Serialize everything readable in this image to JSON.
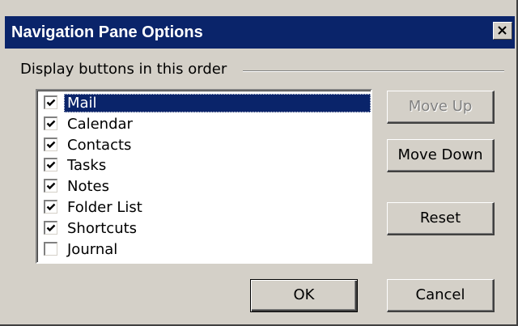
{
  "dialog": {
    "title": "Navigation Pane Options",
    "group_label": "Display buttons in this order"
  },
  "items": [
    {
      "label": "Mail",
      "checked": true,
      "selected": true
    },
    {
      "label": "Calendar",
      "checked": true,
      "selected": false
    },
    {
      "label": "Contacts",
      "checked": true,
      "selected": false
    },
    {
      "label": "Tasks",
      "checked": true,
      "selected": false
    },
    {
      "label": "Notes",
      "checked": true,
      "selected": false
    },
    {
      "label": "Folder List",
      "checked": true,
      "selected": false
    },
    {
      "label": "Shortcuts",
      "checked": true,
      "selected": false
    },
    {
      "label": "Journal",
      "checked": false,
      "selected": false
    }
  ],
  "buttons": {
    "move_up": "Move Up",
    "move_down": "Move Down",
    "reset": "Reset",
    "ok": "OK",
    "cancel": "Cancel"
  },
  "colors": {
    "titlebar": "#0a246a",
    "face": "#d4d0c8",
    "selection": "#0a246a"
  }
}
